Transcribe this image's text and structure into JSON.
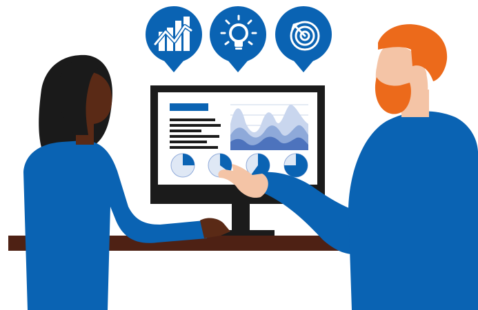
{
  "illustration": {
    "colors": {
      "brand_blue": "#0a63b3",
      "shirt_blue": "#0a63b3",
      "shirt_blue_dark": "#07549b",
      "light_blue": "#dfe8f5",
      "mid_blue": "#8ea9d9",
      "desk": "#4e2114",
      "monitor_frame": "#1b1b1b",
      "woman_skin": "#5a2a16",
      "woman_hair": "#1a1a1a",
      "man_skin": "#f4c4a6",
      "man_hair_beard": "#ec6a1b"
    },
    "icons": [
      {
        "name": "growth-chart-icon"
      },
      {
        "name": "lightbulb-icon"
      },
      {
        "name": "target-icon"
      }
    ],
    "dashboard": {
      "pie_fill_fractions": [
        0.25,
        0.35,
        0.6,
        0.75
      ]
    }
  }
}
